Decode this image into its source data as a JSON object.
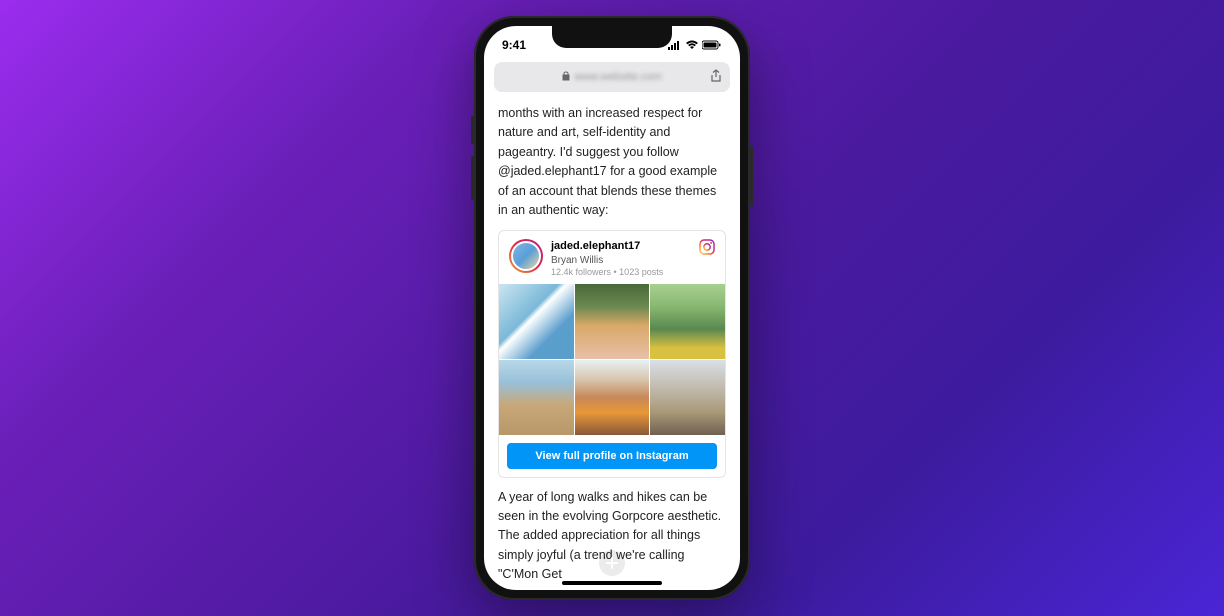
{
  "status": {
    "time": "9:41"
  },
  "browser": {
    "url_placeholder": "www.website.com"
  },
  "article": {
    "paragraph_top": "months with an increased respect for nature and art, self-identity and pageantry. I'd suggest you follow @jaded.elephant17 for a good example of an account that blends these themes in an authentic way:",
    "paragraph_bottom": "A year of long walks and hikes can be seen in the evolving Gorpcore aesthetic. The added appreciation for all things simply joyful (a trend we're calling \"C'Mon Get"
  },
  "embed": {
    "username": "jaded.elephant17",
    "display_name": "Bryan Willis",
    "stats": "12.4k followers • 1023 posts",
    "cta_label": "View full profile on Instagram"
  }
}
